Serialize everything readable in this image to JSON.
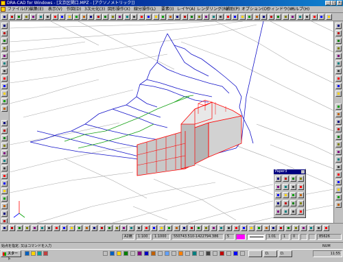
{
  "window": {
    "title": "DRA-CAD for Windows - [文京区関口.MPZ - [アクソノメトリック]]",
    "buttons": [
      "_",
      "□",
      "×"
    ]
  },
  "menu": [
    "ファイル(F)",
    "編集(E)",
    "表示(V)",
    "作図(D)",
    "3次元化(3)",
    "図形操作(X)",
    "線分操作(L)",
    "要素(I)",
    "レイヤ(A)",
    "レンダリング(R)",
    "補助(P)",
    "オプション(O)",
    "ウィンドウ(W)",
    "ヘルプ(H)"
  ],
  "palette": {
    "title": "Paper3"
  },
  "status": {
    "layer": "A2横",
    "scale1": "1:100",
    "scale2": "1:1000",
    "coords": "550743.510-1422794.386",
    "field": "5",
    "color": "#ff00ff",
    "ratio": "1:01",
    "value1": "1",
    "value2": "0",
    "value3": "85626"
  },
  "message": {
    "text": "始点を指定. 又はコマンドを入力",
    "num": "NUM"
  },
  "taskbar": {
    "start_label": "スタート",
    "task1": "",
    "task2": "D.",
    "task3": "D.",
    "clock": "11:55"
  },
  "colors": {
    "title_bar": "#000080",
    "model_red": "#ff0000",
    "blue_lines": "#0000cc",
    "green_lines": "#00aa00",
    "grid_lines": "#a0a0a0"
  }
}
